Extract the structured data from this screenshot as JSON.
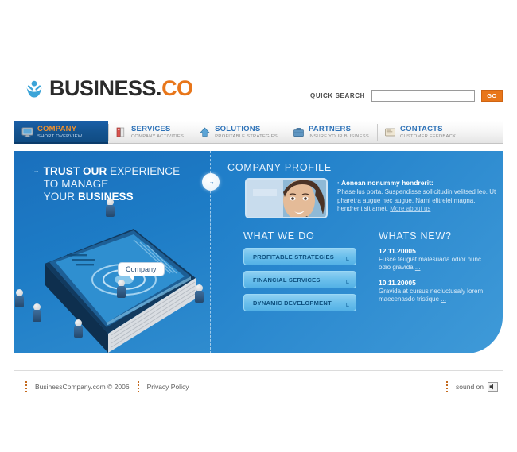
{
  "brand": {
    "name_main": "BUSINESS",
    "name_dot": ".",
    "name_accent": "CO",
    "logo_icon": "person-figure-icon",
    "accent_color": "#e8761a",
    "primary_blue": "#1c76c4"
  },
  "search": {
    "label": "QUICK SEARCH",
    "value": "",
    "placeholder": "",
    "button_label": "GO"
  },
  "nav": {
    "items": [
      {
        "title": "COMPANY",
        "sub": "SHORT OVERVIEW",
        "icon": "monitor-icon",
        "active": true
      },
      {
        "title": "SERVICES",
        "sub": "COMPANY ACTIVITIES",
        "icon": "books-icon",
        "active": false
      },
      {
        "title": "SOLUTIONS",
        "sub": "PROFITABLE STRATEGIES",
        "icon": "up-arrow-icon",
        "active": false
      },
      {
        "title": "PARTNERS",
        "sub": "INSURE YOUR BUSINESS",
        "icon": "briefcase-icon",
        "active": false
      },
      {
        "title": "CONTACTS",
        "sub": "CUSTOMER FEEDBACK",
        "icon": "card-file-icon",
        "active": false
      }
    ]
  },
  "hero": {
    "arrows": "·→",
    "line1_bold": "TRUST OUR",
    "line1_rest": " EXPERIENCE",
    "line2": "TO MANAGE",
    "line3_rest": "YOUR ",
    "line3_bold": "BUSINESS",
    "circle_button_glyph": "·→",
    "book_tooltip": "Company"
  },
  "profile": {
    "heading": "COMPANY PROFILE",
    "photo_alt": "woman-portrait-photo",
    "lead_bullet": "·",
    "lead": "Aenean nonummy hendrerit:",
    "body": "Phasellus porta. Suspendisse sollicitudin velitsed leo. Ut pharetra augue nec augue. Nami elitrelei magna, hendrerit sit amet. ",
    "more_link": "More about us"
  },
  "what_we_do": {
    "heading": "WHAT WE DO",
    "buttons": [
      {
        "label": "PROFITABLE STRATEGIES",
        "arrow": "↳"
      },
      {
        "label": "FINANCIAL SERVICES",
        "arrow": "↳"
      },
      {
        "label": "DYNAMIC DEVELOPMENT",
        "arrow": "↳"
      }
    ]
  },
  "whats_new": {
    "heading": "WHATS NEW?",
    "items": [
      {
        "date": "12.11.20005",
        "text": "Fusce feugiat malesuada odior nunc odio gravida ",
        "more": "..."
      },
      {
        "date": "10.11.20005",
        "text": "Gravida at cursus necluctusaly lorem maecenasdo tristique ",
        "more": "..."
      }
    ]
  },
  "footer": {
    "copyright": "BusinessCompany.com © 2006",
    "privacy": "Privacy Policy",
    "sound_label": "sound on",
    "sound_icon": "speaker-icon"
  }
}
